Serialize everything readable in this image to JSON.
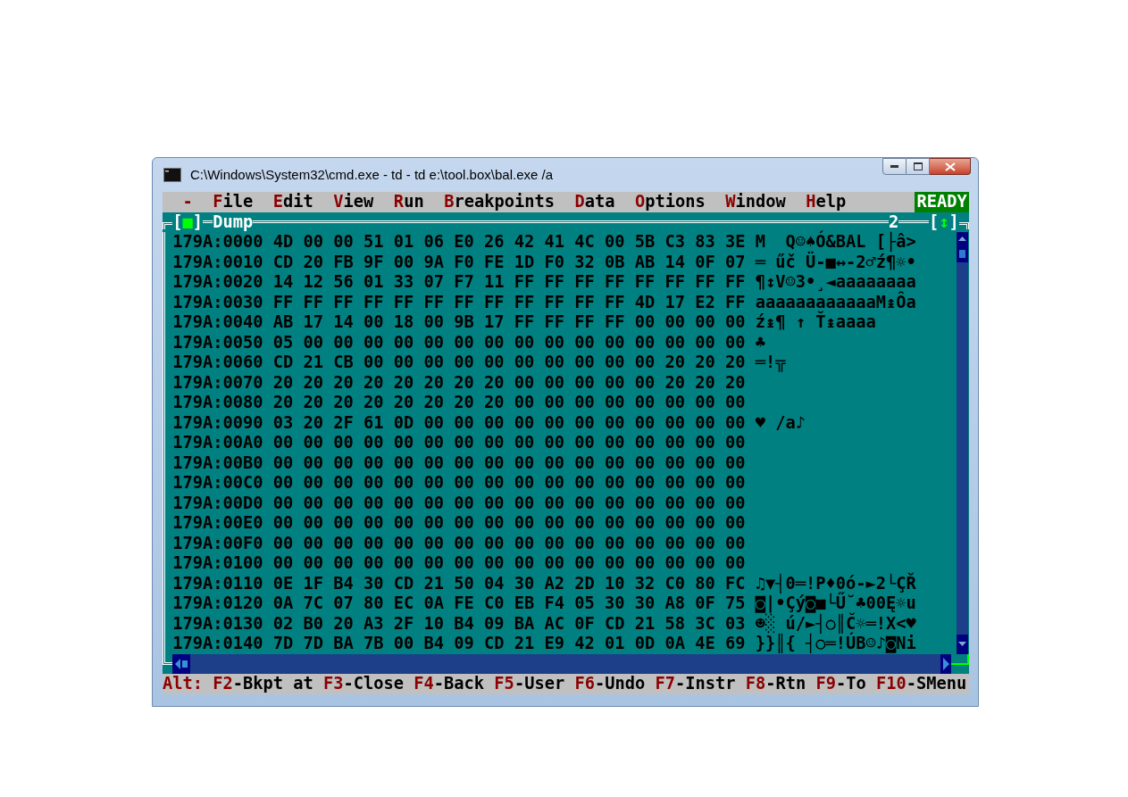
{
  "window": {
    "title": "C:\\Windows\\System32\\cmd.exe - td - td e:\\tool.box\\bal.exe /a"
  },
  "menu": {
    "system": "-",
    "items": [
      {
        "hotkey": "F",
        "rest": "ile"
      },
      {
        "hotkey": "E",
        "rest": "dit"
      },
      {
        "hotkey": "V",
        "rest": "iew"
      },
      {
        "hotkey": "R",
        "rest": "un"
      },
      {
        "hotkey": "B",
        "rest": "reakpoints"
      },
      {
        "hotkey": "D",
        "rest": "ata"
      },
      {
        "hotkey": "O",
        "rest": "ptions"
      },
      {
        "hotkey": "W",
        "rest": "indow"
      },
      {
        "hotkey": "H",
        "rest": "elp"
      }
    ],
    "status": "READY"
  },
  "dump": {
    "brackets": [
      "[",
      "]"
    ],
    "close_box": "■",
    "title": "Dump",
    "number": "2",
    "zoom_box": "↕",
    "rows": [
      {
        "address": "179A:0000",
        "hex": "4D 00 00 51 01 06 E0 26 42 41 4C 00 5B C3 83 3E",
        "ascii": "M  Q☺♠Ó&BAL [├â>"
      },
      {
        "address": "179A:0010",
        "hex": "CD 20 FB 9F 00 9A F0 FE 1D F0 32 0B AB 14 0F 07",
        "ascii": "═ űč Ü-■↔-2♂ź¶☼•"
      },
      {
        "address": "179A:0020",
        "hex": "14 12 56 01 33 07 F7 11 FF FF FF FF FF FF FF FF",
        "ascii": "¶↕V☺3•¸◄aaaaaaaa"
      },
      {
        "address": "179A:0030",
        "hex": "FF FF FF FF FF FF FF FF FF FF FF FF 4D 17 E2 FF",
        "ascii": "aaaaaaaaaaaaM↨Ôa"
      },
      {
        "address": "179A:0040",
        "hex": "AB 17 14 00 18 00 9B 17 FF FF FF FF 00 00 00 00",
        "ascii": "ź↨¶ ↑ Ť↨aaaa"
      },
      {
        "address": "179A:0050",
        "hex": "05 00 00 00 00 00 00 00 00 00 00 00 00 00 00 00",
        "ascii": "♣"
      },
      {
        "address": "179A:0060",
        "hex": "CD 21 CB 00 00 00 00 00 00 00 00 00 00 20 20 20",
        "ascii": "═!╦"
      },
      {
        "address": "179A:0070",
        "hex": "20 20 20 20 20 20 20 20 00 00 00 00 00 20 20 20",
        "ascii": ""
      },
      {
        "address": "179A:0080",
        "hex": "20 20 20 20 20 20 20 20 00 00 00 00 00 00 00 00",
        "ascii": ""
      },
      {
        "address": "179A:0090",
        "hex": "03 20 2F 61 0D 00 00 00 00 00 00 00 00 00 00 00",
        "ascii": "♥ /a♪"
      },
      {
        "address": "179A:00A0",
        "hex": "00 00 00 00 00 00 00 00 00 00 00 00 00 00 00 00",
        "ascii": ""
      },
      {
        "address": "179A:00B0",
        "hex": "00 00 00 00 00 00 00 00 00 00 00 00 00 00 00 00",
        "ascii": ""
      },
      {
        "address": "179A:00C0",
        "hex": "00 00 00 00 00 00 00 00 00 00 00 00 00 00 00 00",
        "ascii": ""
      },
      {
        "address": "179A:00D0",
        "hex": "00 00 00 00 00 00 00 00 00 00 00 00 00 00 00 00",
        "ascii": ""
      },
      {
        "address": "179A:00E0",
        "hex": "00 00 00 00 00 00 00 00 00 00 00 00 00 00 00 00",
        "ascii": ""
      },
      {
        "address": "179A:00F0",
        "hex": "00 00 00 00 00 00 00 00 00 00 00 00 00 00 00 00",
        "ascii": ""
      },
      {
        "address": "179A:0100",
        "hex": "00 00 00 00 00 00 00 00 00 00 00 00 00 00 00 00",
        "ascii": ""
      },
      {
        "address": "179A:0110",
        "hex": "0E 1F B4 30 CD 21 50 04 30 A2 2D 10 32 C0 80 FC",
        "ascii": "♫▼┤0═!P♦0ó-►2└ÇŘ"
      },
      {
        "address": "179A:0120",
        "hex": "0A 7C 07 80 EC 0A FE C0 EB F4 05 30 30 A8 0F 75",
        "ascii": "◙|•Çý◙■└Ű˘♣00Ę☼u"
      },
      {
        "address": "179A:0130",
        "hex": "02 B0 20 A3 2F 10 B4 09 BA AC 0F CD 21 58 3C 03",
        "ascii": "☻░ ú/►┤○║Č☼═!X<♥"
      },
      {
        "address": "179A:0140",
        "hex": "7D 7D BA 7B 00 B4 09 CD 21 E9 42 01 0D 0A 4E 69",
        "ascii": "}}║{ ┤○═!ÚB☺♪◙Ni"
      }
    ]
  },
  "status_bar": {
    "prefix": "Alt:",
    "keys": [
      {
        "key": "F2",
        "label": "-Bkpt at"
      },
      {
        "key": "F3",
        "label": "-Close"
      },
      {
        "key": "F4",
        "label": "-Back"
      },
      {
        "key": "F5",
        "label": "-User"
      },
      {
        "key": "F6",
        "label": "-Undo"
      },
      {
        "key": "F7",
        "label": "-Instr"
      },
      {
        "key": "F8",
        "label": "-Rtn"
      },
      {
        "key": "F9",
        "label": "-To"
      },
      {
        "key": "F10",
        "label": "-SMenu"
      }
    ]
  }
}
